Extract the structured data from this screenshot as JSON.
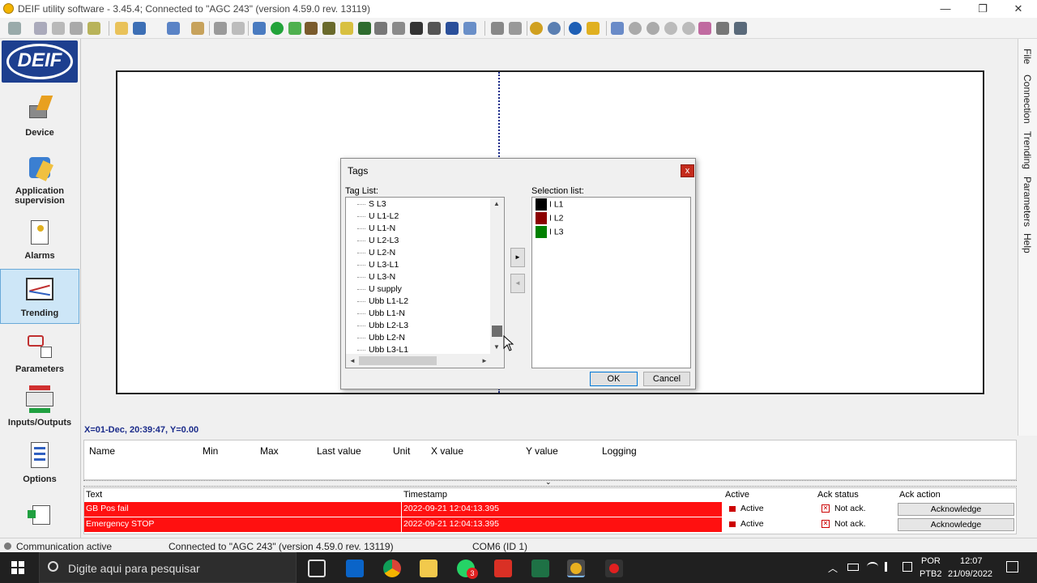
{
  "window": {
    "title": "DEIF utility software - 3.45.4; Connected to \"AGC 243\" (version 4.59.0 rev. 13119)",
    "minimize": "—",
    "maximize": "❐",
    "close": "✕"
  },
  "logo_text": "DEIF",
  "nav": {
    "items": [
      {
        "label": "Device"
      },
      {
        "label": "Application supervision"
      },
      {
        "label": "Alarms"
      },
      {
        "label": "Trending"
      },
      {
        "label": "Parameters"
      },
      {
        "label": "Inputs/Outputs"
      },
      {
        "label": "Options"
      }
    ],
    "scroll_arrow": "▼"
  },
  "right_tabs": [
    "File",
    "Connection",
    "Trending",
    "Parameters",
    "Help"
  ],
  "cursor_readout": "X=01-Dec, 20:39:47, Y=0.00",
  "legend_grid": {
    "headers": [
      "Name",
      "Min",
      "Max",
      "Last value",
      "Unit",
      "X value",
      "Y value",
      "Logging"
    ]
  },
  "splitter_arrow": "⌄",
  "alarms": {
    "headers": [
      "Text",
      "Timestamp",
      "Active",
      "Ack status",
      "Ack action"
    ],
    "rows": [
      {
        "text": "GB Pos fail",
        "timestamp": "2022-09-21 12:04:13.395",
        "active": "Active",
        "ack_status": "Not ack.",
        "ack_action": "Acknowledge"
      },
      {
        "text": "Emergency STOP",
        "timestamp": "2022-09-21 12:04:13.395",
        "active": "Active",
        "ack_status": "Not ack.",
        "ack_action": "Acknowledge"
      }
    ],
    "x_glyph": "✕"
  },
  "statusbar": {
    "communication": "Communication active",
    "connection": "Connected to \"AGC 243\" (version 4.59.0 rev. 13119)",
    "port": "COM6 (ID 1)"
  },
  "dialog": {
    "title": "Tags",
    "close": "x",
    "tag_list_label": "Tag List:",
    "selection_list_label": "Selection list:",
    "tags": [
      "S L3",
      "U L1-L2",
      "U L1-N",
      "U L2-L3",
      "U L2-N",
      "U L3-L1",
      "U L3-N",
      "U supply",
      "Ubb L1-L2",
      "Ubb L1-N",
      "Ubb L2-L3",
      "Ubb L2-N",
      "Ubb L3-L1"
    ],
    "selection": [
      {
        "name": "I L1",
        "color": "#000000"
      },
      {
        "name": "I L2",
        "color": "#8b0000"
      },
      {
        "name": "I L3",
        "color": "#008000"
      }
    ],
    "add_arrow": "►",
    "remove_arrow": "◄",
    "scroll_up": "▲",
    "scroll_down": "▼",
    "scroll_left": "◄",
    "scroll_right": "►",
    "ok": "OK",
    "cancel": "Cancel"
  },
  "taskbar": {
    "search_placeholder": "Digite aqui para pesquisar",
    "language": "POR",
    "layout": "PTB2",
    "time": "12:07",
    "date": "21/09/2022",
    "whatsapp_badge": "3"
  },
  "colors": {
    "alarm_red": "#ff1010",
    "selection_blue": "#cde6f7",
    "deif_blue": "#1d3f8f"
  }
}
